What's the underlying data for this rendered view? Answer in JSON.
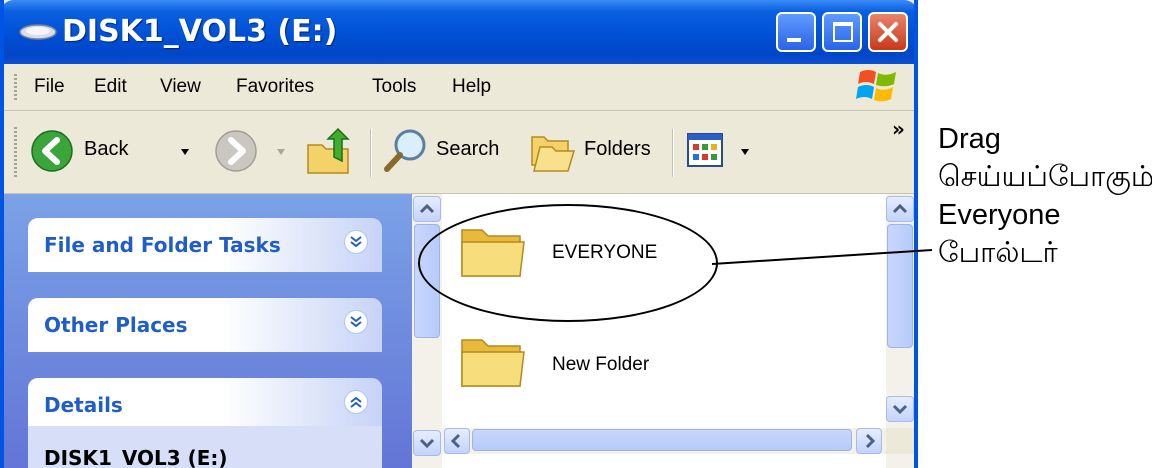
{
  "window": {
    "title": "DISK1_VOL3 (E:)"
  },
  "menu": {
    "items": [
      "File",
      "Edit",
      "View",
      "Favorites",
      "Tools",
      "Help"
    ]
  },
  "toolbar": {
    "back_label": "Back",
    "search_label": "Search",
    "folders_label": "Folders",
    "overflow": "»"
  },
  "tasks": {
    "panels": [
      "File and Folder Tasks",
      "Other Places",
      "Details"
    ],
    "details_text": "DISK1_VOL3 (E:)"
  },
  "files": {
    "items": [
      "EVERYONE",
      "New Folder"
    ]
  },
  "annotation": {
    "lines": [
      "Drag",
      "செய்யப்போகும்",
      "Everyone",
      "போல்டர்"
    ]
  },
  "colors": {
    "title_bar": "#0054e3",
    "task_pane": "#6d8fe0",
    "panel_title": "#215dc6"
  }
}
